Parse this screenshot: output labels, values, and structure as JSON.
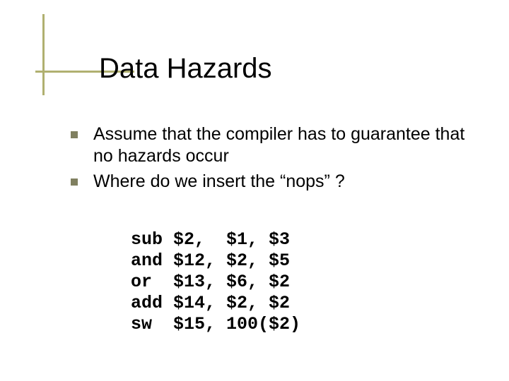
{
  "title": "Data Hazards",
  "bullets": [
    "Assume that the compiler has to guarantee that no hazards occur",
    "Where do we insert the “nops” ?"
  ],
  "code": "sub $2,  $1, $3\nand $12, $2, $5\nor  $13, $6, $2\nadd $14, $2, $2\nsw  $15, 100($2)"
}
